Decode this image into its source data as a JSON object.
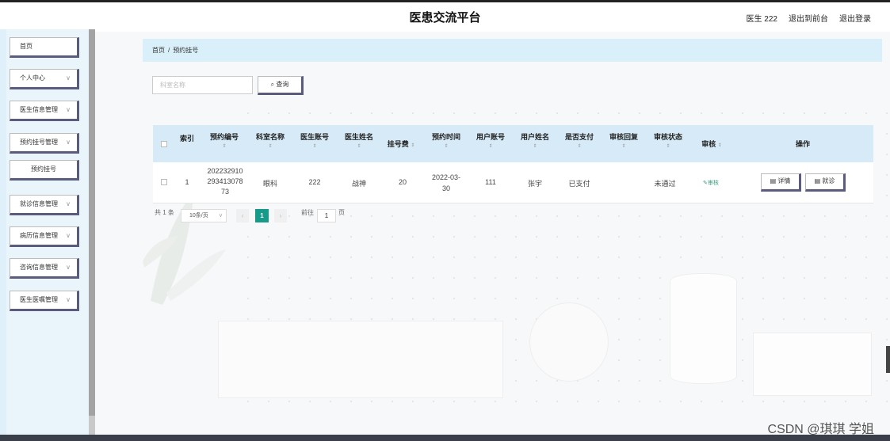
{
  "header": {
    "title": "医患交流平台",
    "user": "医生 222",
    "back_frontend": "退出到前台",
    "logout": "退出登录"
  },
  "sidebar": {
    "items": [
      {
        "label": "首页"
      },
      {
        "label": "个人中心"
      },
      {
        "label": "医生信息管理"
      },
      {
        "label": "预约挂号管理"
      },
      {
        "label": "预约挂号"
      },
      {
        "label": "就诊信息管理"
      },
      {
        "label": "病历信息管理"
      },
      {
        "label": "咨询信息管理"
      },
      {
        "label": "医生医嘱管理"
      }
    ]
  },
  "breadcrumb": {
    "home": "首页",
    "separator": "/",
    "current": "预约挂号"
  },
  "search": {
    "placeholder": "科室名称",
    "button_label": "查询"
  },
  "table": {
    "columns": [
      "索引",
      "预约编号",
      "科室名称",
      "医生账号",
      "医生姓名",
      "挂号费",
      "预约时间",
      "用户账号",
      "用户姓名",
      "是否支付",
      "审核回复",
      "审核状态",
      "审核",
      "操作"
    ],
    "rows": [
      {
        "index": "1",
        "booking_no": "20223291029341307873",
        "booking_no_lines": [
          "202232910",
          "293413078",
          "73"
        ],
        "department": "眼科",
        "doctor_account": "222",
        "doctor_name": "战神",
        "fee": "20",
        "booking_time_lines": [
          "2022-03-",
          "30"
        ],
        "user_account": "111",
        "user_name": "张宇",
        "paid": "已支付",
        "audit_reply": "",
        "audit_status": "未通过",
        "audit_action": "审核",
        "detail_label": "详情",
        "visit_label": "就诊"
      }
    ]
  },
  "pagination": {
    "total": "共 1 条",
    "page_size": "10条/页",
    "current_page": "1",
    "goto_label": "前往",
    "goto_value": "1",
    "page_unit": "页"
  },
  "watermark": "CSDN @琪琪 学姐"
}
